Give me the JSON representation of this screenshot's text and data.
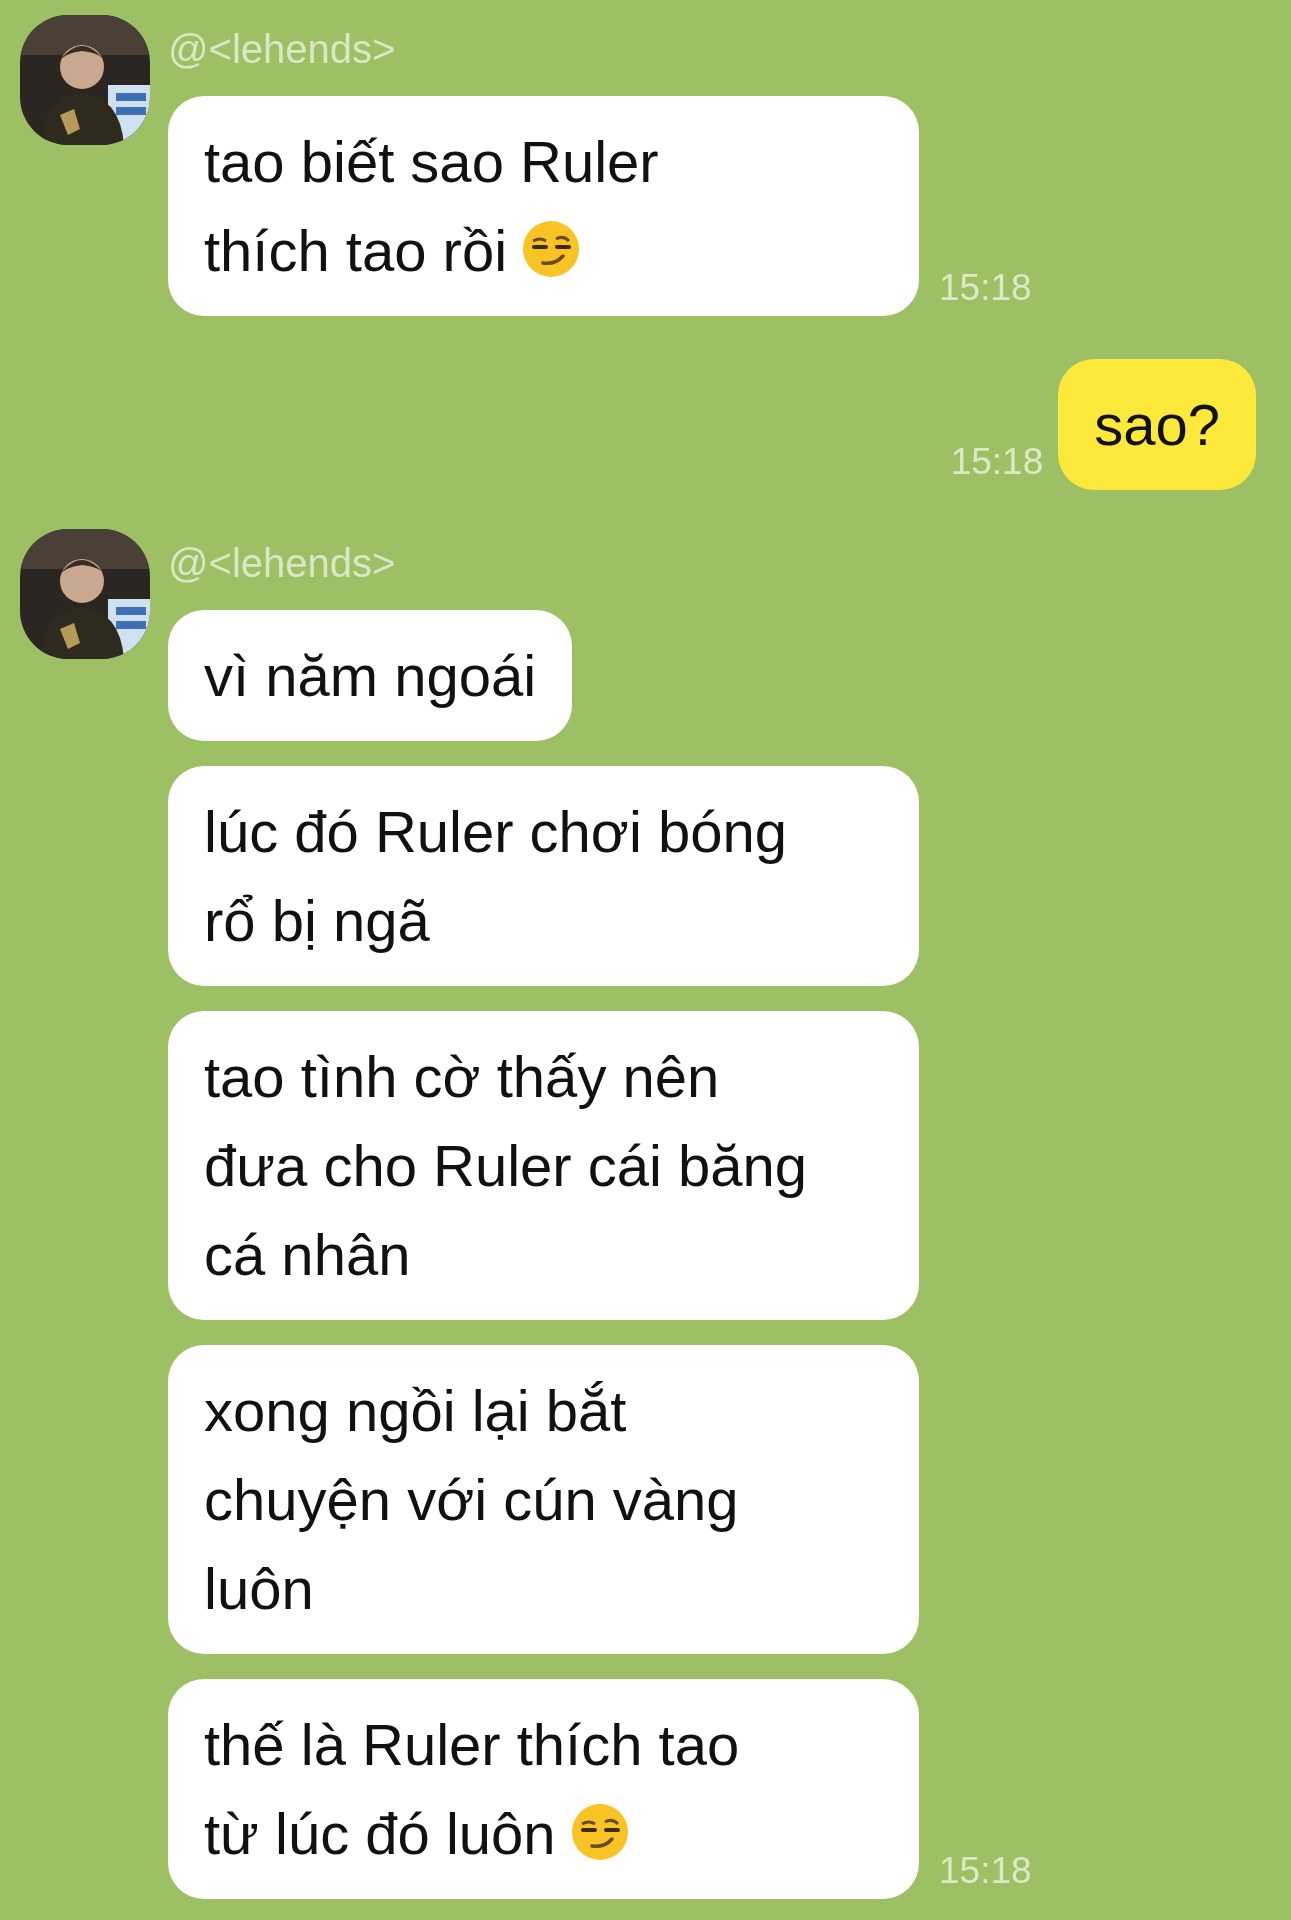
{
  "conversation": [
    {
      "kind": "received",
      "sender": "@<lehends>",
      "time": "15:18",
      "messages": [
        {
          "lines": [
            "tao biết sao Ruler",
            "thích tao rồi"
          ],
          "trailing_emoji": true
        }
      ]
    },
    {
      "kind": "sent",
      "time": "15:18",
      "messages": [
        {
          "lines": [
            "sao?"
          ]
        }
      ]
    },
    {
      "kind": "received",
      "sender": "@<lehends>",
      "time": "15:18",
      "messages": [
        {
          "lines": [
            "vì năm ngoái"
          ]
        },
        {
          "lines": [
            "lúc đó Ruler chơi bóng",
            "rổ bị ngã"
          ]
        },
        {
          "lines": [
            "tao tình cờ thấy nên",
            "đưa cho Ruler cái băng",
            "cá nhân"
          ]
        },
        {
          "lines": [
            "xong ngồi lại bắt",
            "chuyện với cún vàng",
            "luôn"
          ]
        },
        {
          "lines": [
            "thế là Ruler thích tao",
            "từ lúc đó luôn"
          ],
          "trailing_emoji": true
        }
      ]
    }
  ]
}
